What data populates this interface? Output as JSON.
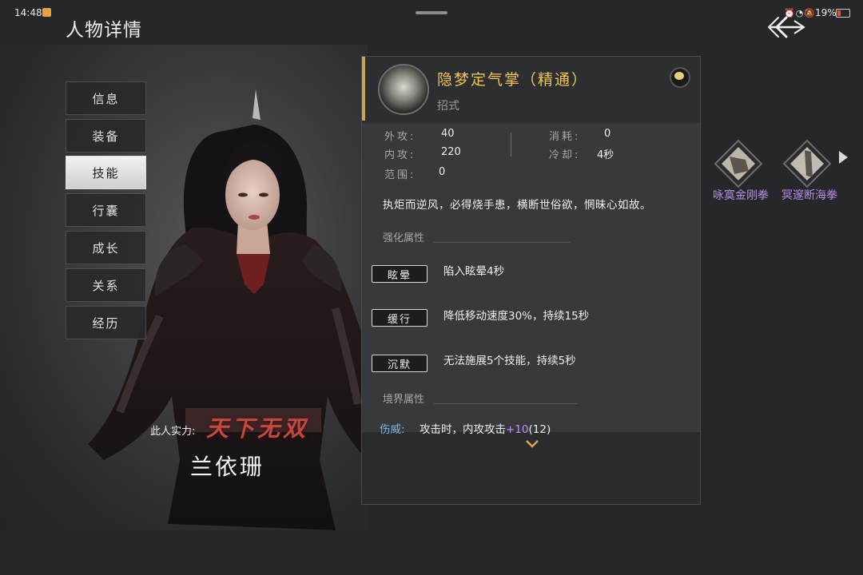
{
  "status_bar": {
    "time": "14:48",
    "icons": "⏰◔🔕",
    "battery": "19%"
  },
  "page_title": "人物详情",
  "menu": [
    {
      "label": "信息",
      "active": false
    },
    {
      "label": "装备",
      "active": false
    },
    {
      "label": "技能",
      "active": true
    },
    {
      "label": "行囊",
      "active": false
    },
    {
      "label": "成长",
      "active": false
    },
    {
      "label": "关系",
      "active": false
    },
    {
      "label": "经历",
      "active": false
    }
  ],
  "character": {
    "strength_prefix": "此人实力:",
    "strength": "天下无双",
    "name": "兰依珊"
  },
  "skill_detail": {
    "name": "隐梦定气掌（精通）",
    "type": "招式",
    "stats": {
      "outer_attack_label": "外攻:",
      "outer_attack": "40",
      "inner_attack_label": "内攻:",
      "inner_attack": "220",
      "range_label": "范围:",
      "range": "0",
      "cost_label": "消耗:",
      "cost": "0",
      "cooldown_label": "冷却:",
      "cooldown": "4秒"
    },
    "description": "执炬而逆风，必得烧手患，横断世俗欲，惘昧心如故。",
    "enhance_title": "强化属性",
    "effects": [
      {
        "tag": "眩晕",
        "desc": "陷入眩晕4秒"
      },
      {
        "tag": "缓行",
        "desc": "降低移动速度30%，持续15秒"
      },
      {
        "tag": "沉默",
        "desc": "无法施展5个技能，持续5秒"
      }
    ],
    "realm_title": "境界属性",
    "realm": {
      "name": "伤威:",
      "desc": "攻击时，内攻攻击",
      "bonus": "+10",
      "total": "(12)"
    }
  },
  "skill_list": [
    {
      "label": "咏寞金刚拳"
    },
    {
      "label": "冥邃断海拳"
    }
  ],
  "colors": {
    "accent_gold": "#f0c54a",
    "strength_red": "#c44a3f",
    "skill_purple": "#b98be6",
    "realm_blue": "#7fb3e6"
  }
}
